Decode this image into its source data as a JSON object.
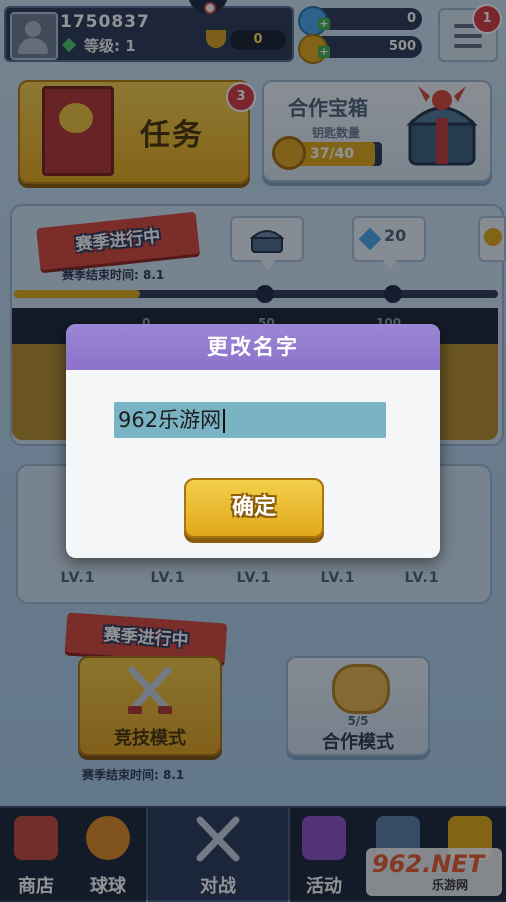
{
  "top_bar": {
    "player_id": "1750837",
    "level_text": "等级: 1",
    "trophy_value": "0",
    "diamonds": "0",
    "coins": "500",
    "menu_badge": "1"
  },
  "task": {
    "label": "任务",
    "badge": "3"
  },
  "coop_chest": {
    "title": "合作宝箱",
    "key_label": "钥匙数量",
    "key_value": "37/40",
    "key_progress": 0.925
  },
  "season": {
    "ribbon": "赛季进行中",
    "end_text": "赛季结束时间: 8.1",
    "progress": 0.26,
    "reward_diamonds": "20",
    "track_numbers": [
      "0",
      "50",
      "100"
    ]
  },
  "levels": [
    "LV.1",
    "LV.1",
    "LV.1",
    "LV.1",
    "LV.1"
  ],
  "modes": {
    "ribbon": "赛季进行中",
    "arena_label": "竞技模式",
    "coop_count": "5/5",
    "coop_label": "合作模式",
    "end_text": "赛季结束时间: 8.1"
  },
  "nav": {
    "shop": "商店",
    "balls": "球球",
    "battle": "对战",
    "events": "活动"
  },
  "watermark": {
    "main": "962.NET",
    "sub": "乐游网"
  },
  "dialog": {
    "title": "更改名字",
    "input_value": "962乐游网",
    "confirm": "确定"
  },
  "colors": {
    "dialog_header": "#8c72c9",
    "confirm_button": "#e1a81c",
    "input_bg": "#7ab3c3"
  }
}
